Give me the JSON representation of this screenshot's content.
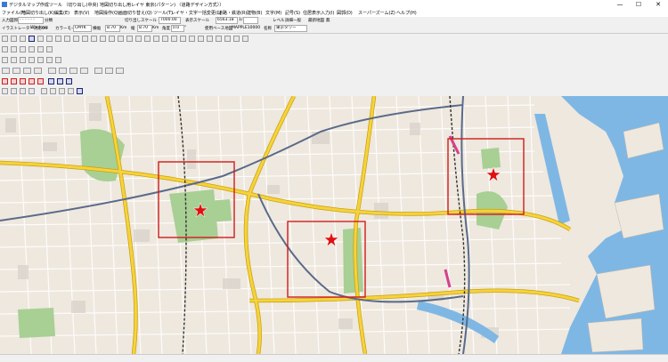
{
  "window": {
    "title": "デジタルマップ作成ツール 〔切り出し(中央) 地図切り出し用レイヤ 東京(パターン) 〈道路デザイン方式〉〕",
    "minimize": "—",
    "maximize": "☐",
    "close": "✕"
  },
  "menu": [
    "ファイル(F)",
    "地図切り出し(K)",
    "編集(E)",
    "表示(V)",
    "地図操作(Q)",
    "画面切り替え(Q)",
    "ツール(T)",
    "レイヤ・文字一括変更(L)",
    "道路・鉄道(R)",
    "建物(B)",
    "文字(M)",
    "記号(S)",
    "住居表示入力(I)",
    "図郭(D)",
    "スーパーズーム(Z)",
    "ヘルプ(H)"
  ],
  "info": {
    "input_label": "入力図郭",
    "input_value": "- - - - - -",
    "division_label": "分類",
    "cutout_scale_label": "切り出しスケール",
    "cutout_scale_value": "7000.00",
    "display_scale_label": "表示スケール",
    "display_scale_value": "6563.18",
    "scale_prefix": "1/",
    "level_label": "レベル",
    "level_value": "詳細一般",
    "latest_label": "最新地図",
    "latest_value": "無",
    "illustrator_label": "イラストレーター対応OS",
    "illustrator_value": "Windows",
    "color_mode_label": "カラーモード",
    "color_mode_value": "CMYK",
    "width_label": "横幅",
    "width_value": "8.70",
    "width_unit": "Km",
    "height_label": "縦",
    "height_value": "8.70",
    "height_unit": "Km",
    "angle_label": "角度",
    "angle_value": "0.0",
    "angle_unit": "°",
    "map_base_label": "使用ベース地図",
    "map_base_value": "MAPPLE10000",
    "name_label": "名称",
    "name_value": "東京タワー"
  },
  "map": {
    "markers": [
      "selection-1",
      "selection-2",
      "selection-3"
    ]
  },
  "colors": {
    "highway": "#f6d23c",
    "highway_outline": "#c9a20a",
    "river": "#7fb7e4",
    "park": "#a8cf94",
    "selection": "#d01c1c",
    "star": "#e01010"
  }
}
